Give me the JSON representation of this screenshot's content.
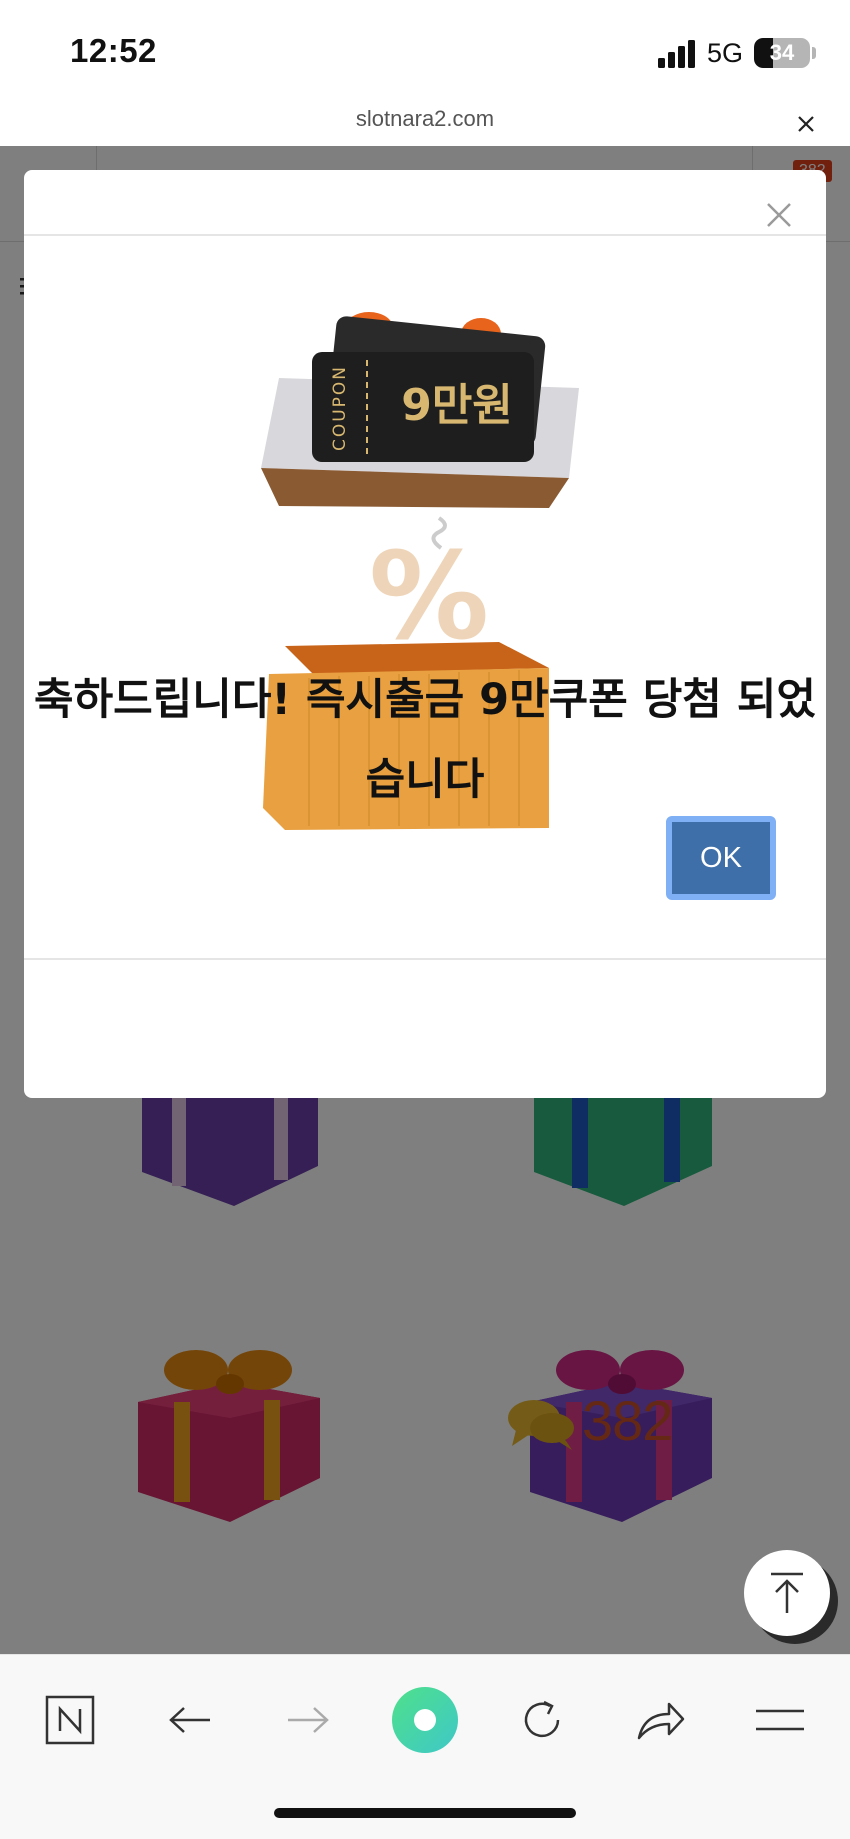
{
  "status_bar": {
    "time": "12:52",
    "network": "5G",
    "battery": "34",
    "battery_level": 0.34
  },
  "browser": {
    "url": "slotnara2.com"
  },
  "page": {
    "badge": "382",
    "comment_count": "382"
  },
  "modal": {
    "coupon_word": "COUPON",
    "coupon_amount": "9만원",
    "message": "축하드립니다! 즉시출금 9만쿠폰 당첨 되었습니다",
    "ok_label": "OK"
  },
  "icons": {
    "signal": "signal-icon",
    "battery": "battery-icon",
    "close": "close-icon",
    "naver": "naver-n-icon",
    "back": "arrow-left-icon",
    "forward": "arrow-right-icon",
    "green_dot": "green-circle-icon",
    "reload": "reload-icon",
    "share": "share-icon",
    "menu": "hamburger-menu-icon",
    "scroll_top": "arrow-up-icon",
    "comment": "speech-bubbles-icon"
  },
  "colors": {
    "ok_button": "#3f6fa8",
    "ok_border": "#7fb0f5",
    "comment_count": "#c8502a",
    "badge": "#e0401a"
  }
}
